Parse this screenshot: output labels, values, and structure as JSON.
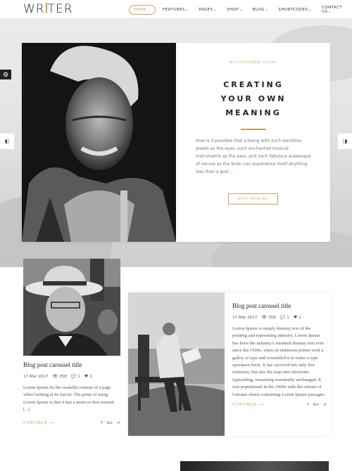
{
  "header": {
    "logo": "WRITER",
    "nav": [
      {
        "label": "HOME",
        "active": true
      },
      {
        "label": "FEATURES",
        "active": false
      },
      {
        "label": "PAGES",
        "active": false
      },
      {
        "label": "SHOP",
        "active": false
      },
      {
        "label": "BLOG",
        "active": false
      },
      {
        "label": "SHORTCODES",
        "active": false
      },
      {
        "label": "CONTACT US",
        "active": false
      }
    ]
  },
  "hero": {
    "category": "MOTIVATIONAL ESSAY",
    "title": "CREATING\nYOUR OWN\nMEANING",
    "excerpt": "How is it possible that a being with such sensitive jewels as the eyes, such enchanted musical instruments as the ears, and such fabulous arabesque of nerves as the brain can experience itself anything less than a god ...",
    "button": "KEEP READING",
    "settings_icon": "gear-icon",
    "prev_icon": "chevron-left-icon",
    "next_icon": "chevron-right-icon"
  },
  "posts": [
    {
      "title": "Blog post carousel title",
      "date": "17 Mar 2017",
      "views": "358",
      "comments": "1",
      "likes": "1",
      "text": "Lorem Ipsum by the readable content of a page when looking at its layout. The point of using Lorem Ipsum is that it has a more-or-less normal [...]",
      "continue": "CONTINUE"
    },
    {
      "title": "Blog post carousel title",
      "date": "17 Mar 2017",
      "views": "358",
      "comments": "1",
      "likes": "1",
      "text": "Lorem Ipsum is simply dummy text of the printing and typesetting industry. Lorem Ipsum has been the industry's standard dummy text ever since the 1500s, when an unknown printer took a galley of type and scrambled it to make a type specimen book. It has survived not only five centuries, but also the leap into electronic typesetting, remaining essentially unchanged. It was popularised in the 1960s with the release of Letraset sheets containing Lorem Ipsum passages.",
      "continue": "CONTINUE"
    }
  ],
  "colors": {
    "accent": "#c7a15a",
    "dark": "#222222"
  }
}
